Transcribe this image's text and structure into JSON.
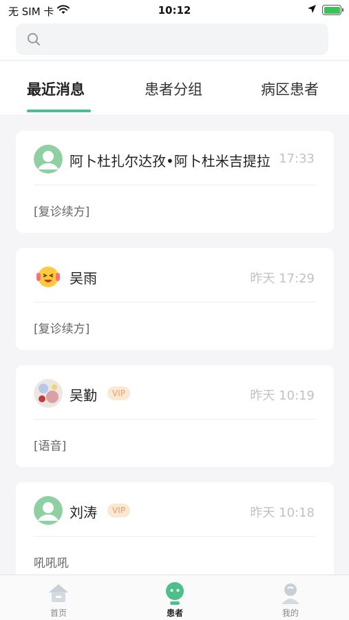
{
  "status_bar": {
    "carrier": "无 SIM 卡",
    "time": "10:12"
  },
  "search": {
    "placeholder": "",
    "value": ""
  },
  "tabs": [
    {
      "label": "最近消息",
      "active": true
    },
    {
      "label": "患者分组",
      "active": false
    },
    {
      "label": "病区患者",
      "active": false
    }
  ],
  "conversations": [
    {
      "name": "阿卜杜扎尔达孜•阿卜杜米吉提拉",
      "vip": "",
      "time": "17:33",
      "preview": "[复诊续方]",
      "avatar": "default-avatar-icon"
    },
    {
      "name": "吴雨",
      "vip": "",
      "time": "昨天 17:29",
      "preview": "[复诊续方]",
      "avatar": "emoji-avatar"
    },
    {
      "name": "吴勤",
      "vip": "VIP",
      "time": "昨天 10:19",
      "preview": "[语音]",
      "avatar": "photo-avatar"
    },
    {
      "name": "刘涛",
      "vip": "VIP",
      "time": "昨天 10:18",
      "preview": "吼吼吼",
      "avatar": "default-avatar-icon"
    }
  ],
  "bottom_nav": [
    {
      "label": "首页",
      "icon": "home-icon",
      "active": false
    },
    {
      "label": "患者",
      "icon": "patient-icon",
      "active": true
    },
    {
      "label": "我的",
      "icon": "profile-icon",
      "active": false
    }
  ],
  "colors": {
    "accent": "#4cbf8c",
    "vip_bg": "#fbe7d2",
    "vip_text": "#e0a36b"
  }
}
